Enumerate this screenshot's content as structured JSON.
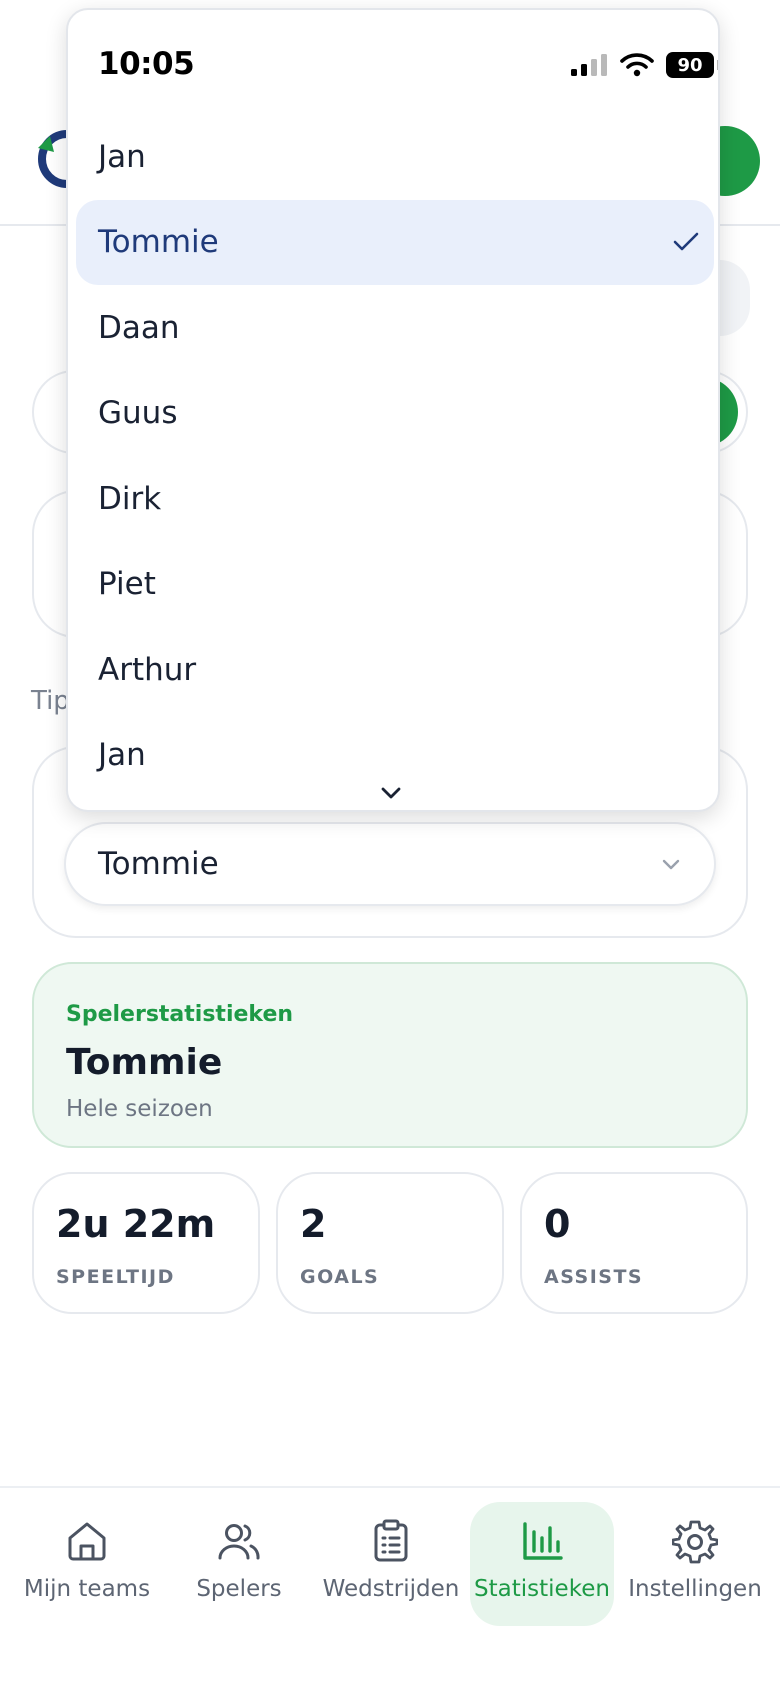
{
  "status_bar": {
    "time": "10:05",
    "battery": "90",
    "icons": [
      "signal-icon",
      "wifi-icon",
      "battery-icon"
    ]
  },
  "dropdown": {
    "options": [
      "Jan",
      "Tommie",
      "Daan",
      "Guus",
      "Dirk",
      "Piet",
      "Arthur",
      "Jan"
    ],
    "selected_index": 1,
    "selected_icon": "checkmark-icon",
    "more_icon": "chevron-down-icon"
  },
  "page": {
    "hint_text": "Tip",
    "player_select": {
      "value": "Tommie",
      "icon": "chevron-down-icon"
    }
  },
  "player_card": {
    "kicker": "Spelerstatistieken",
    "name": "Tommie",
    "period": "Hele seizoen"
  },
  "stats": [
    {
      "value": "2u 22m",
      "label": "SPEELTIJD"
    },
    {
      "value": "2",
      "label": "GOALS"
    },
    {
      "value": "0",
      "label": "ASSISTS"
    }
  ],
  "nav": {
    "items": [
      {
        "label": "Mijn teams",
        "icon": "home-icon"
      },
      {
        "label": "Spelers",
        "icon": "users-icon"
      },
      {
        "label": "Wedstrijden",
        "icon": "clipboard-icon"
      },
      {
        "label": "Statistieken",
        "icon": "bar-chart-icon"
      },
      {
        "label": "Instellingen",
        "icon": "gear-icon"
      }
    ],
    "active_index": 3
  },
  "colors": {
    "brand_green": "#1e9a46",
    "brand_navy": "#1f3a7a",
    "selected_bg": "#e9effb",
    "player_card_bg": "#eff8f2"
  }
}
